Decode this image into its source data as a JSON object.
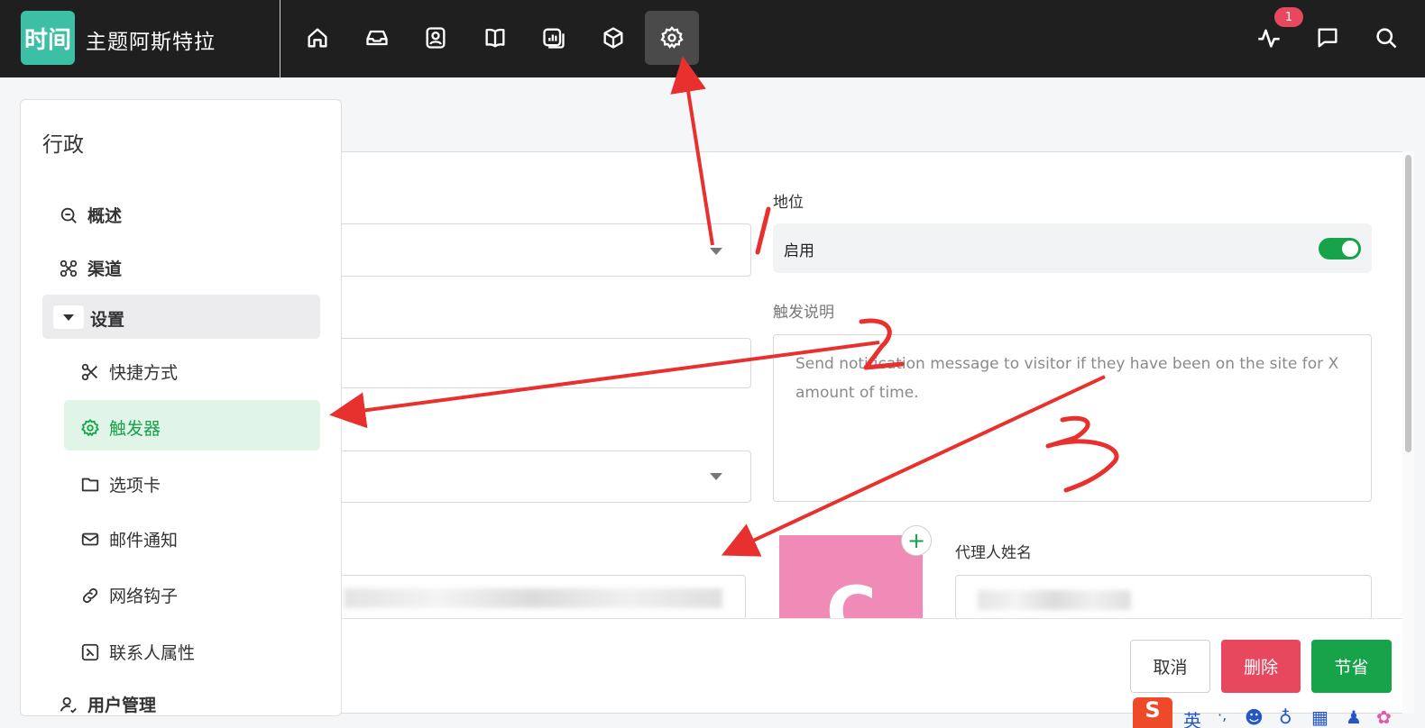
{
  "app": {
    "logo_text": "时间",
    "brand_name": "主题阿斯特拉",
    "notification_count": "1"
  },
  "topnav": {
    "icons": [
      "home-icon",
      "inbox-icon",
      "contacts-icon",
      "book-icon",
      "reports-icon",
      "box-icon",
      "gear-icon"
    ],
    "active": "gear-icon",
    "right_icons": [
      "activity-icon",
      "chat-icon",
      "search-icon"
    ]
  },
  "sidebar": {
    "title": "行政",
    "items": [
      {
        "label": "概述",
        "icon": "overview-icon"
      },
      {
        "label": "渠道",
        "icon": "channels-icon"
      },
      {
        "label": "设置",
        "icon": "chevron-down-icon",
        "expanded": true
      },
      {
        "label": "快捷方式",
        "icon": "scissors-icon"
      },
      {
        "label": "触发器",
        "icon": "gear-icon",
        "active": true
      },
      {
        "label": "选项卡",
        "icon": "folder-icon"
      },
      {
        "label": "邮件通知",
        "icon": "mail-icon"
      },
      {
        "label": "网络钩子",
        "icon": "link-icon"
      },
      {
        "label": "联系人属性",
        "icon": "attribute-icon"
      },
      {
        "label": "用户管理",
        "icon": "user-icon"
      }
    ]
  },
  "form": {
    "status_label": "地位",
    "status_value": "启用",
    "status_enabled": true,
    "description_label": "触发说明",
    "description_placeholder": "Send notification message to visitor if they have been on the site for X amount of time.",
    "agent_name_label": "代理人姓名",
    "avatar_letter": "C"
  },
  "actions": {
    "cancel": "取消",
    "delete": "删除",
    "save": "节省"
  },
  "ime": {
    "logo": "S",
    "lang": "英"
  },
  "annotations": {
    "marks": [
      "1",
      "2",
      "3"
    ],
    "color": "#e8302e"
  },
  "colors": {
    "accent": "#16a34a",
    "danger": "#e8485e",
    "topbar": "#1f1f1f",
    "logo": "#3cbfa4",
    "avatar": "#f08bb8"
  }
}
